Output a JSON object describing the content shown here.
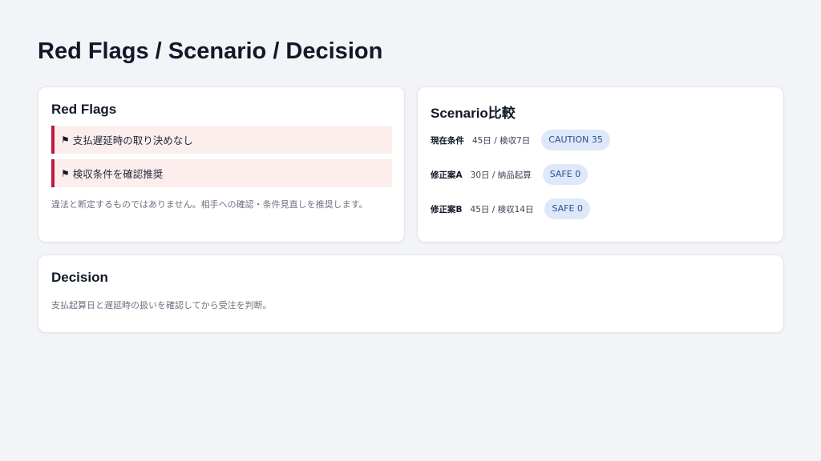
{
  "page": {
    "title": "Red Flags / Scenario / Decision"
  },
  "red_flags": {
    "title": "Red Flags",
    "items": [
      {
        "icon": "⚑",
        "text": "支払遅延時の取り決めなし"
      },
      {
        "icon": "⚑",
        "text": "検収条件を確認推奨"
      }
    ],
    "note": "違法と断定するものではありません。相手への確認・条件見直しを推奨します。"
  },
  "scenario": {
    "title": "Scenario比較",
    "rows": [
      {
        "label": "現在条件",
        "detail": "45日 / 検収7日",
        "badge": "CAUTION 35"
      },
      {
        "label": "修正案A",
        "detail": "30日 / 納品起算",
        "badge": "SAFE 0"
      },
      {
        "label": "修正案B",
        "detail": "45日 / 検収14日",
        "badge": "SAFE 0"
      }
    ]
  },
  "decision": {
    "title": "Decision",
    "text": "支払起算日と遅延時の扱いを確認してから受注を判断。"
  },
  "colors": {
    "flag_border": "#b91c3a",
    "flag_bg": "#fdeeee",
    "badge_bg": "#dde8fb",
    "badge_text": "#2f4f8a"
  }
}
